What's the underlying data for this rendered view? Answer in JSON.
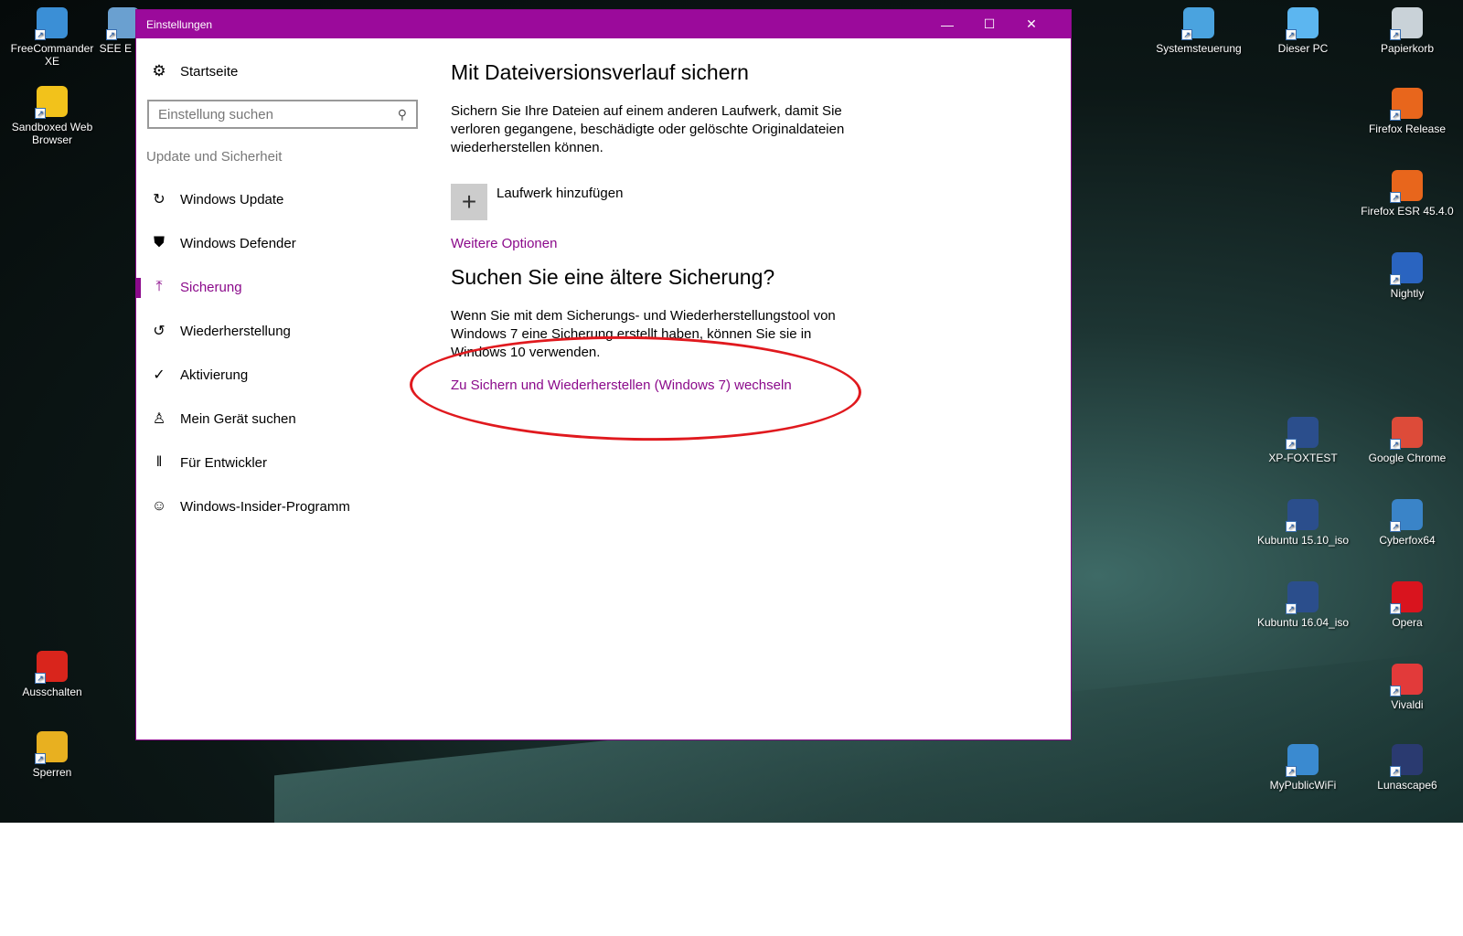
{
  "desktop": {
    "left_icons": [
      "FreeCommander XE",
      "SEE E Sc",
      "Sandboxed Web Browser",
      "Ausschalten",
      "Sperren"
    ],
    "right_icons": [
      "Systemsteuerung",
      "Dieser PC",
      "Papierkorb",
      "Firefox Release",
      "Firefox ESR 45.4.0",
      "Nightly",
      "XP-FOXTEST",
      "Google Chrome",
      "Kubuntu 15.10_iso",
      "Cyberfox64",
      "Kubuntu 16.04_iso",
      "Opera",
      "Vivaldi",
      "MyPublicWiFi",
      "Lunascape6"
    ]
  },
  "window": {
    "title": "Einstellungen",
    "controls": {
      "minimize": "—",
      "maximize": "☐",
      "close": "✕"
    }
  },
  "sidebar": {
    "home": "Startseite",
    "search_placeholder": "Einstellung suchen",
    "section": "Update und Sicherheit",
    "items": [
      {
        "label": "Windows Update",
        "icon": "↻"
      },
      {
        "label": "Windows Defender",
        "icon": "⛊"
      },
      {
        "label": "Sicherung",
        "icon": "⤒"
      },
      {
        "label": "Wiederherstellung",
        "icon": "↺"
      },
      {
        "label": "Aktivierung",
        "icon": "✓"
      },
      {
        "label": "Mein Gerät suchen",
        "icon": "♙"
      },
      {
        "label": "Für Entwickler",
        "icon": "‖"
      },
      {
        "label": "Windows-Insider-Programm",
        "icon": "☺"
      }
    ],
    "active_index": 2
  },
  "main": {
    "heading1": "Mit Dateiversionsverlauf sichern",
    "desc1": "Sichern Sie Ihre Dateien auf einem anderen Laufwerk, damit Sie verloren gegangene, beschädigte oder gelöschte Originaldateien wiederherstellen können.",
    "add_drive": "Laufwerk hinzufügen",
    "more_options": "Weitere Optionen",
    "heading2": "Suchen Sie eine ältere Sicherung?",
    "desc2": "Wenn Sie mit dem Sicherungs- und Wiederherstellungstool von Windows 7 eine Sicherung erstellt haben, können Sie sie in Windows 10 verwenden.",
    "win7_link": "Zu Sichern und Wiederherstellen (Windows 7) wechseln"
  },
  "colors": {
    "accent": "#9b0a9b",
    "annotation": "#e0191e"
  }
}
